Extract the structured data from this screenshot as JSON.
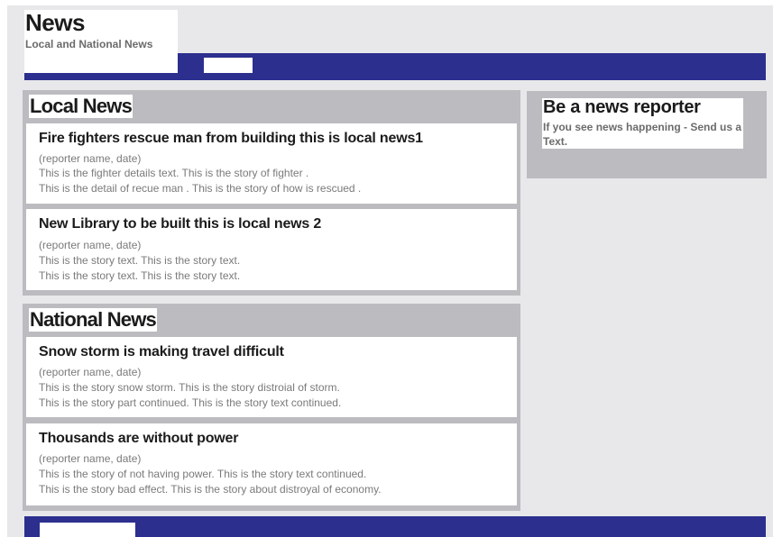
{
  "header": {
    "title": "News",
    "subtitle": "Local and National News"
  },
  "local": {
    "heading": "Local News",
    "stories": [
      {
        "title": "Fire fighters rescue man from building this is local news1",
        "meta": "(reporter name, date)",
        "lines": [
          "This is the fighter details text. This is the story of fighter .",
          "This is the detail of recue man . This is the story of how is rescued ."
        ]
      },
      {
        "title": "New Library to be built this is local news 2",
        "meta": "(reporter name, date)",
        "lines": [
          "This is the story text. This is the story text.",
          "This is the story text. This is the story text."
        ]
      }
    ]
  },
  "national": {
    "heading": "National News",
    "stories": [
      {
        "title": "Snow storm is making travel difficult",
        "meta": "(reporter name, date)",
        "lines": [
          "This is the story snow storm. This is the story distroial of storm.",
          "This is the story part continued. This is the story text continued."
        ]
      },
      {
        "title": "Thousands are without power",
        "meta": "(reporter name, date)",
        "lines": [
          "This is the story of not having power. This is the story text continued.",
          "This is the story bad effect. This is the story about distroyal of economy."
        ]
      }
    ]
  },
  "sidebar": {
    "title": "Be a news reporter",
    "text": "If you see news happening - Send us a Text."
  },
  "colors": {
    "nav": "#2c2f8e",
    "panel": "#bcbcc0",
    "page": "#e8e8ea"
  }
}
